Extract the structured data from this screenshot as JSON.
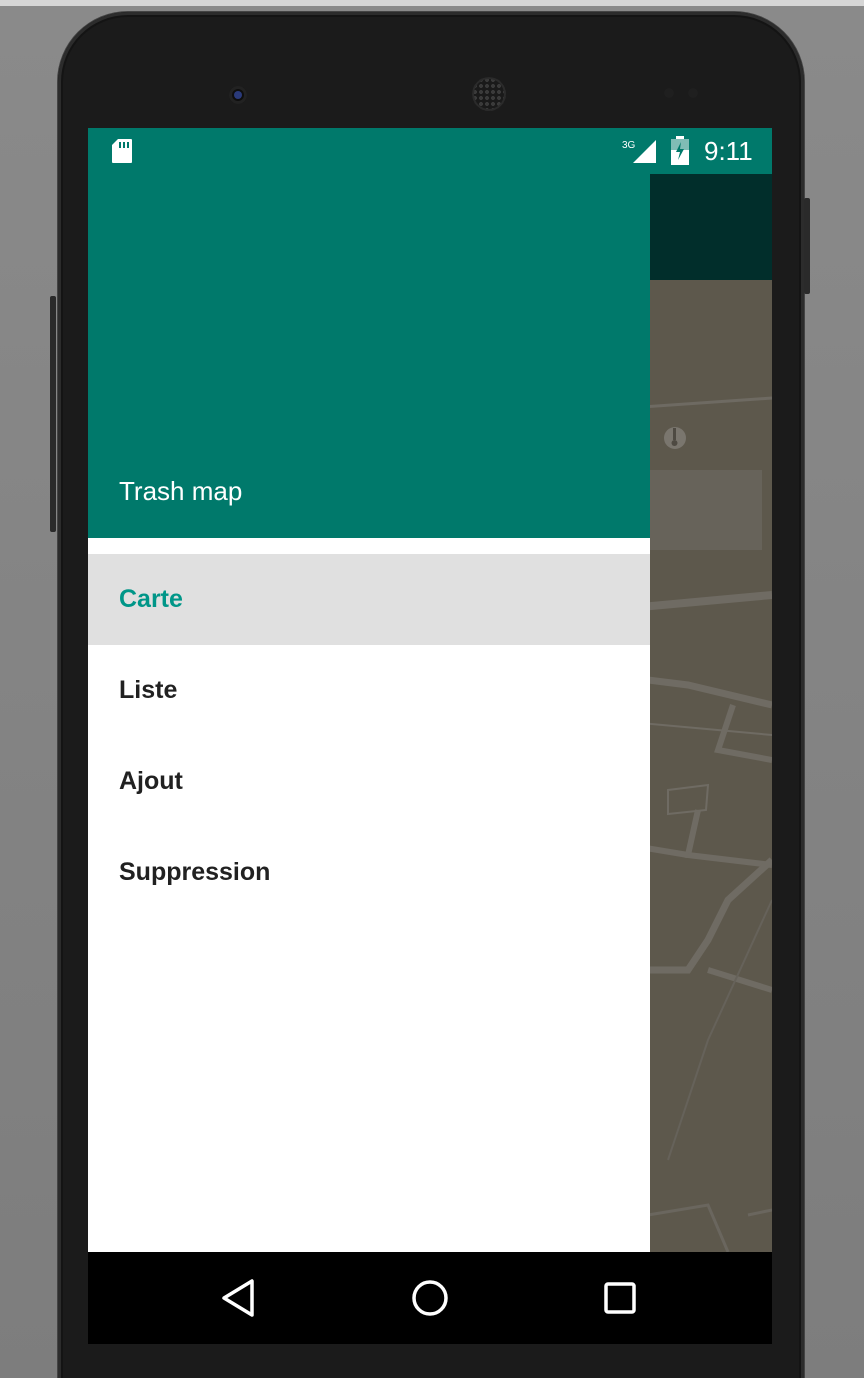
{
  "status_bar": {
    "time": "9:11",
    "network": "3G",
    "icons": [
      "sd-card-icon",
      "signal-3g-icon",
      "battery-charging-icon"
    ]
  },
  "drawer": {
    "title": "Trash map",
    "items": [
      {
        "label": "Carte",
        "selected": true
      },
      {
        "label": "Liste",
        "selected": false
      },
      {
        "label": "Ajout",
        "selected": false
      },
      {
        "label": "Suppression",
        "selected": false
      }
    ]
  },
  "navigation_bar": {
    "buttons": [
      "back-icon",
      "home-icon",
      "recents-icon"
    ]
  },
  "colors": {
    "primary": "#00796b",
    "accent": "#009688",
    "selected_bg": "#e0e0e0",
    "status_bar": "#00796b"
  }
}
